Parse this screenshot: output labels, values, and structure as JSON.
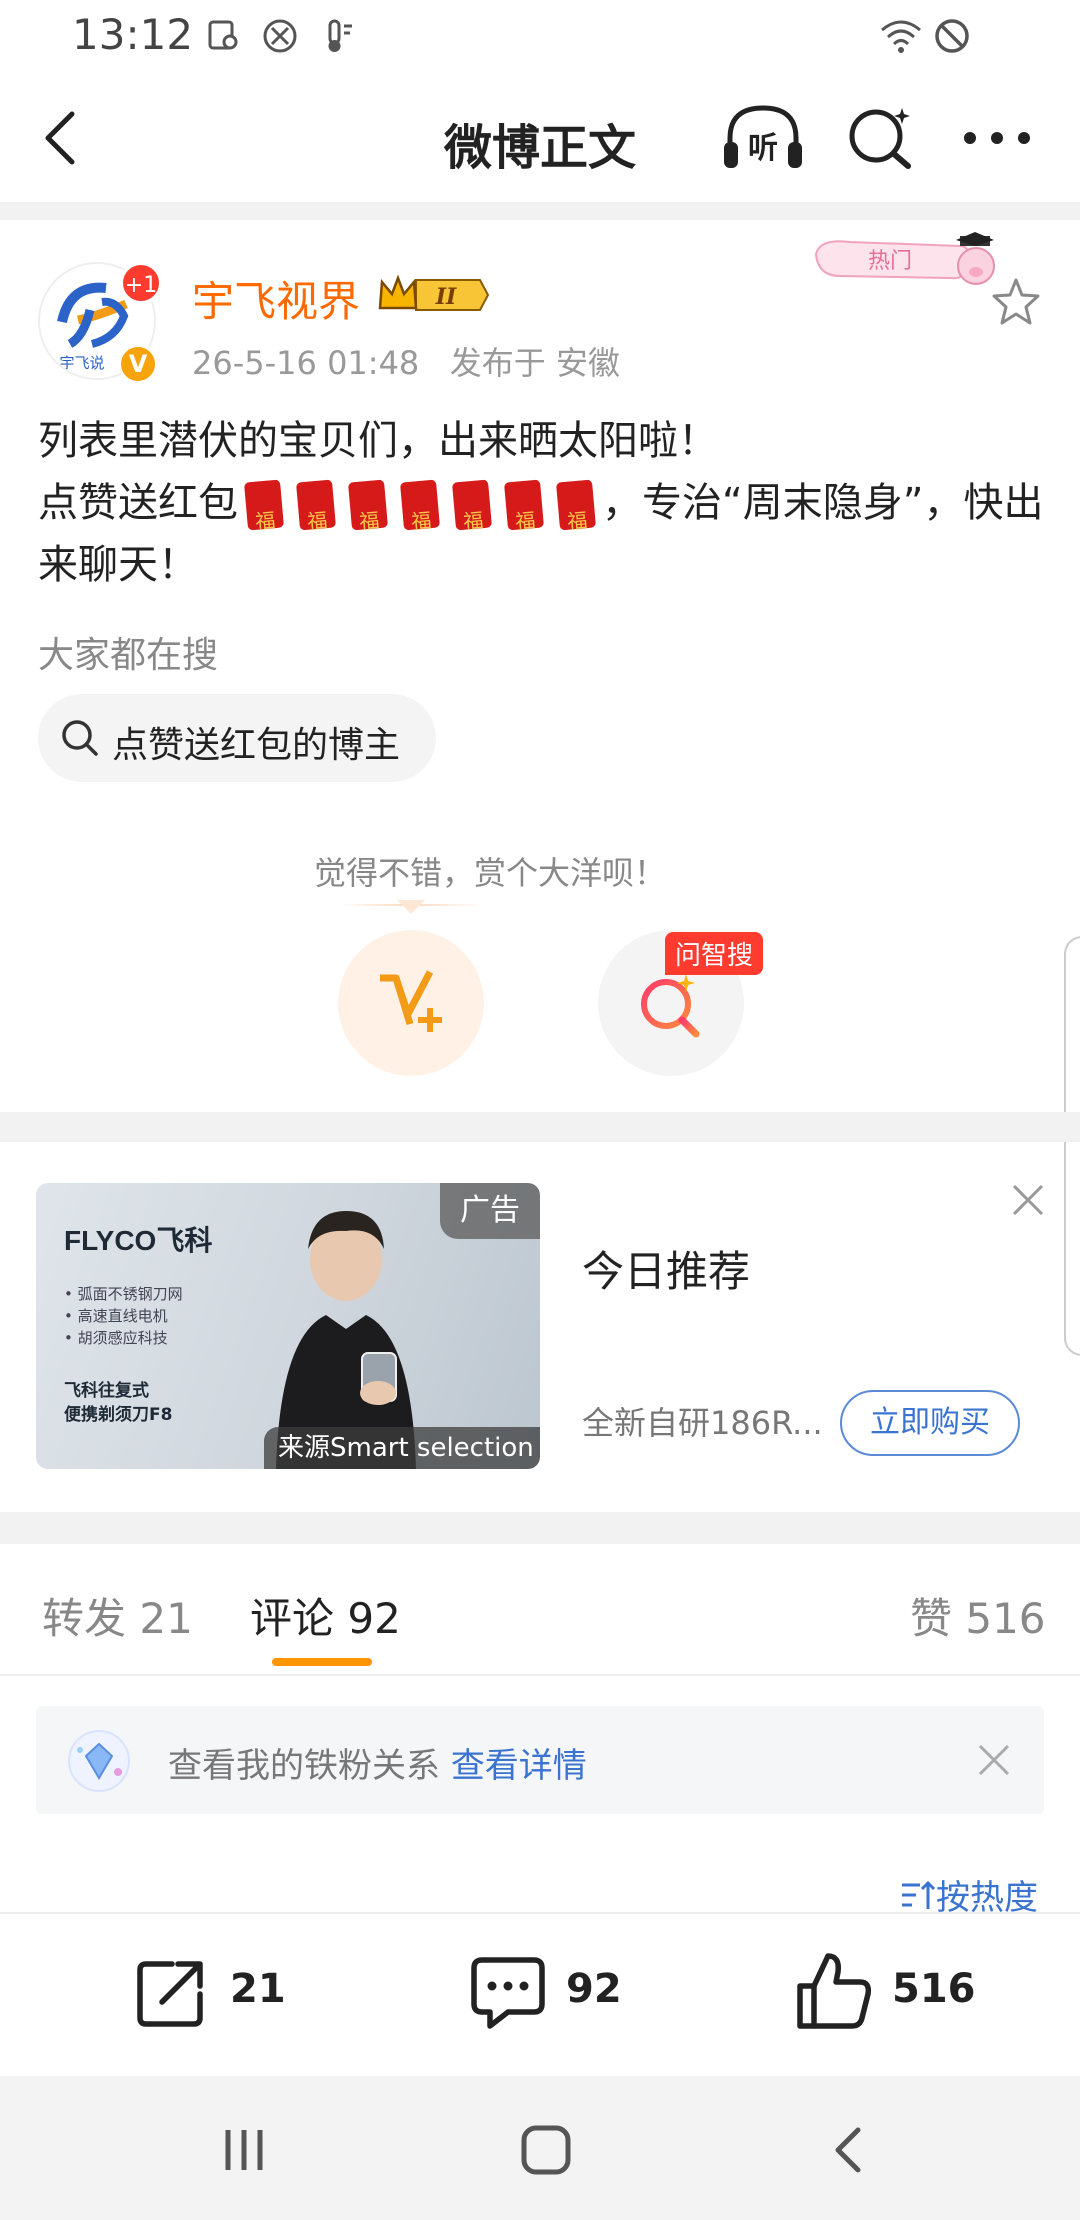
{
  "status_bar": {
    "time": "13:12"
  },
  "nav": {
    "title": "微博正文"
  },
  "post": {
    "author": "宇飞视界",
    "avatar_badge": "+1",
    "avatar_text": "宇飞说",
    "crown_level": "II",
    "time": "26-5-16 01:48",
    "location": "发布于 安徽",
    "hot_sticker": "热门",
    "body_line1": "列表里潜伏的宝贝们，出来晒太阳啦！",
    "body_line2_prefix": "点赞送红包",
    "body_line2_suffix": "，专治“周末隐身”，快出来聊天！",
    "everyone_search_label": "大家都在搜",
    "search_chip": "点赞送红包的博主",
    "reward_hint": "觉得不错，赏个大洋呗！",
    "zhisou_badge": "问智搜"
  },
  "ad": {
    "label": "广告",
    "brand": "FLYCO飞科",
    "features": [
      "弧面不锈钢刀网",
      "高速直线电机",
      "胡须感应科技"
    ],
    "product_line1": "飞科往复式",
    "product_line2": "便携剃须刀F8",
    "source": "来源Smart selection",
    "title": "今日推荐",
    "subtitle": "全新自研186R...",
    "buy_button": "立即购买"
  },
  "tabs": [
    {
      "label": "转发 21"
    },
    {
      "label": "评论 92"
    },
    {
      "label": "赞 516"
    }
  ],
  "fan_banner": {
    "text": "查看我的铁粉关系 ",
    "link": "查看详情"
  },
  "sort": {
    "label": "按热度"
  },
  "actions": {
    "repost": "21",
    "comment": "92",
    "like": "516"
  },
  "colors": {
    "accent": "#ff6a00",
    "link": "#3b74d0",
    "tab_underline": "#ff9500",
    "red_badge": "#ff3b30"
  }
}
